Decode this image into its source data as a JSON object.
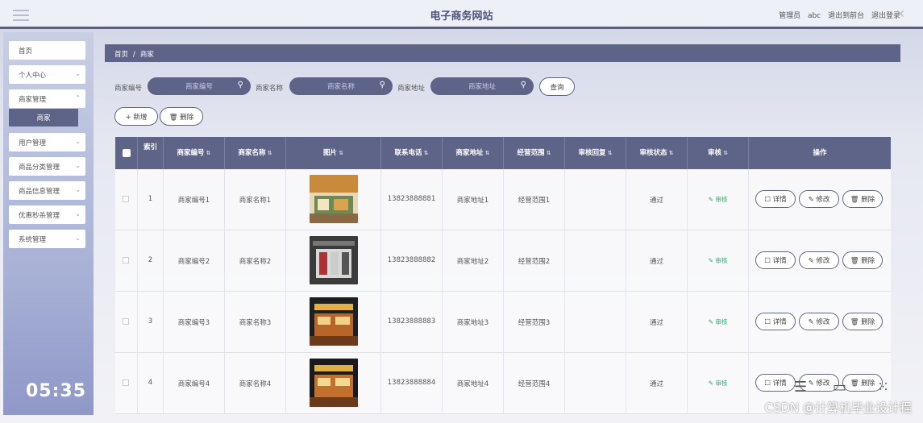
{
  "header": {
    "title": "电子商务网站",
    "role": "管理员",
    "username": "abc",
    "goto_front": "退出到前台",
    "logout": "退出登录"
  },
  "sidebar": {
    "items": [
      {
        "label": "首页",
        "chevron": false
      },
      {
        "label": "个人中心",
        "chevron": true
      },
      {
        "label": "商家管理",
        "chevron": true
      },
      {
        "label": "用户管理",
        "chevron": true
      },
      {
        "label": "商品分类管理",
        "chevron": true
      },
      {
        "label": "商品信息管理",
        "chevron": true
      },
      {
        "label": "优惠秒杀管理",
        "chevron": true
      },
      {
        "label": "系统管理",
        "chevron": true
      }
    ],
    "active_sub": "商家"
  },
  "breadcrumb": {
    "home": "首页",
    "separator": "/",
    "current": "商家"
  },
  "search": {
    "fields": [
      {
        "label": "商家编号",
        "placeholder": "商家编号"
      },
      {
        "label": "商家名称",
        "placeholder": "商家名称"
      },
      {
        "label": "商家地址",
        "placeholder": "商家地址"
      }
    ],
    "query_label": "查询"
  },
  "actions": {
    "add_label": "+ 新增",
    "delete_label": "删除"
  },
  "table": {
    "columns": [
      "索引",
      "商家编号",
      "商家名称",
      "图片",
      "联系电话",
      "商家地址",
      "经营范围",
      "审核回复",
      "审核状态",
      "审核",
      "操作"
    ],
    "rows": [
      {
        "index": "1",
        "code": "商家编号1",
        "name": "商家名称1",
        "phone": "13823888881",
        "address": "商家地址1",
        "scope": "经营范围1",
        "reply": "",
        "status": "通过",
        "audit": "审核"
      },
      {
        "index": "2",
        "code": "商家编号2",
        "name": "商家名称2",
        "phone": "13823888882",
        "address": "商家地址2",
        "scope": "经营范围2",
        "reply": "",
        "status": "通过",
        "audit": "审核"
      },
      {
        "index": "3",
        "code": "商家编号3",
        "name": "商家名称3",
        "phone": "13823888883",
        "address": "商家地址3",
        "scope": "经营范围3",
        "reply": "",
        "status": "通过",
        "audit": "审核"
      },
      {
        "index": "4",
        "code": "商家编号4",
        "name": "商家名称4",
        "phone": "13823888884",
        "address": "商家地址4",
        "scope": "经营范围4",
        "reply": "",
        "status": "通过",
        "audit": "审核"
      }
    ],
    "op_labels": {
      "detail": "详情",
      "edit": "修改",
      "delete": "删除"
    }
  },
  "overlay": {
    "timer": "05:35",
    "watermark": "CSDN @计算机毕业设计程"
  },
  "colors": {
    "primary": "#5e6388",
    "success": "#3aa36c",
    "background": "#e6e8f1"
  }
}
